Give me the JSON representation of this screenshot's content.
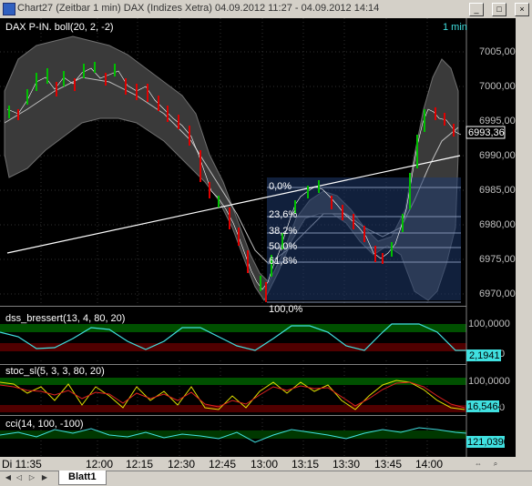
{
  "window": {
    "title": "Chart27 (Zeitbar 1 min)  DAX (Indizes Xetra) 04.09.2012 11:27 - 04.09.2012 14:14",
    "buttons": [
      "_",
      "□",
      "×"
    ]
  },
  "panels": {
    "main": {
      "label": "DAX P-IN. boll(20, 2, -2)",
      "interval": "1 min",
      "price_current": "6993,36",
      "y_ticks": [
        "7005,00",
        "7000,00",
        "6995,00",
        "6990,00",
        "6985,00",
        "6980,00",
        "6975,00",
        "6970,00"
      ],
      "fib_levels": [
        "0,0%",
        "23,6%",
        "38,2%",
        "50,0%",
        "61,8%",
        "100,0%"
      ]
    },
    "dss": {
      "label": "dss_bressert(13, 4, 80, 20)",
      "y_ticks": [
        "100,0000",
        "0"
      ],
      "current": "2,1941"
    },
    "stoc": {
      "label": "stoc_sl(5, 3, 3, 80, 20)",
      "y_ticks": [
        "100,0000",
        "0"
      ],
      "current": "16,5464"
    },
    "cci": {
      "label": "cci(14, 100, -100)",
      "current": "121,0390"
    }
  },
  "time_axis": {
    "labels": [
      "Di 11:35",
      "12:00",
      "12:15",
      "12:30",
      "12:45",
      "13:00",
      "13:15",
      "13:30",
      "13:45",
      "14:00"
    ]
  },
  "sheet_tab": "Blatt1",
  "colors": {
    "up": "#00c000",
    "down": "#e00000",
    "band": "#404040",
    "fib": "#1a2e5a",
    "cyan": "#40e0e0",
    "yellow": "#e0e000"
  },
  "chart_data": {
    "type": "candlestick",
    "series": [
      {
        "name": "DAX",
        "x": [
          "11:35",
          "11:45",
          "12:00",
          "12:15",
          "12:30",
          "12:45",
          "13:00",
          "13:15",
          "13:30",
          "13:45",
          "14:00",
          "14:10"
        ],
        "y": [
          6994,
          6998,
          7001,
          6999,
          6995,
          6983,
          6972,
          6986,
          6980,
          6976,
          6992,
          6993.36
        ]
      }
    ],
    "ylim": [
      6970,
      7005
    ]
  }
}
